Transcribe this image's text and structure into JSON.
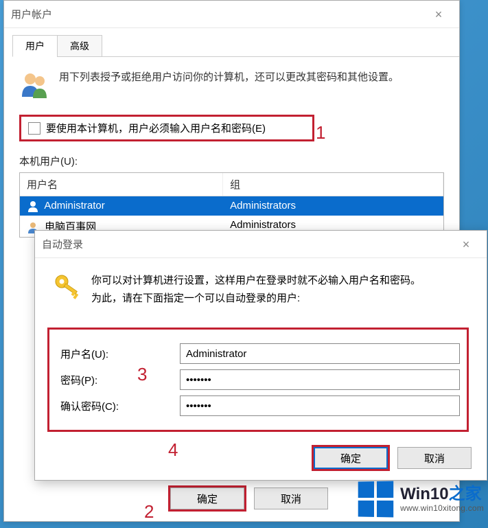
{
  "back_window": {
    "title": "用户帐户",
    "tabs": {
      "users": "用户",
      "advanced": "高级"
    },
    "intro": "用下列表授予或拒绝用户访问你的计算机，还可以更改其密码和其他设置。",
    "checkbox_label": "要使用本计算机，用户必须输入用户名和密码(E)",
    "section_label": "本机用户(U):",
    "table": {
      "col_name": "用户名",
      "col_group": "组",
      "rows": [
        {
          "name": "Administrator",
          "group": "Administrators"
        },
        {
          "name": "电脑百事网",
          "group": "Administrators"
        }
      ]
    },
    "ok": "确定",
    "cancel": "取消"
  },
  "front_window": {
    "title": "自动登录",
    "intro_line1": "你可以对计算机进行设置，这样用户在登录时就不必输入用户名和密码。",
    "intro_line2": "为此，请在下面指定一个可以自动登录的用户:",
    "labels": {
      "username": "用户名(U):",
      "password": "密码(P):",
      "confirm": "确认密码(C):"
    },
    "values": {
      "username": "Administrator",
      "password": "•••••••",
      "confirm": "•••••••"
    },
    "ok": "确定",
    "cancel": "取消"
  },
  "annotations": {
    "a1": "1",
    "a2": "2",
    "a3": "3",
    "a4": "4"
  },
  "watermark": {
    "brand_a": "Win10",
    "brand_b": "之家",
    "url": "www.win10xitong.com"
  }
}
